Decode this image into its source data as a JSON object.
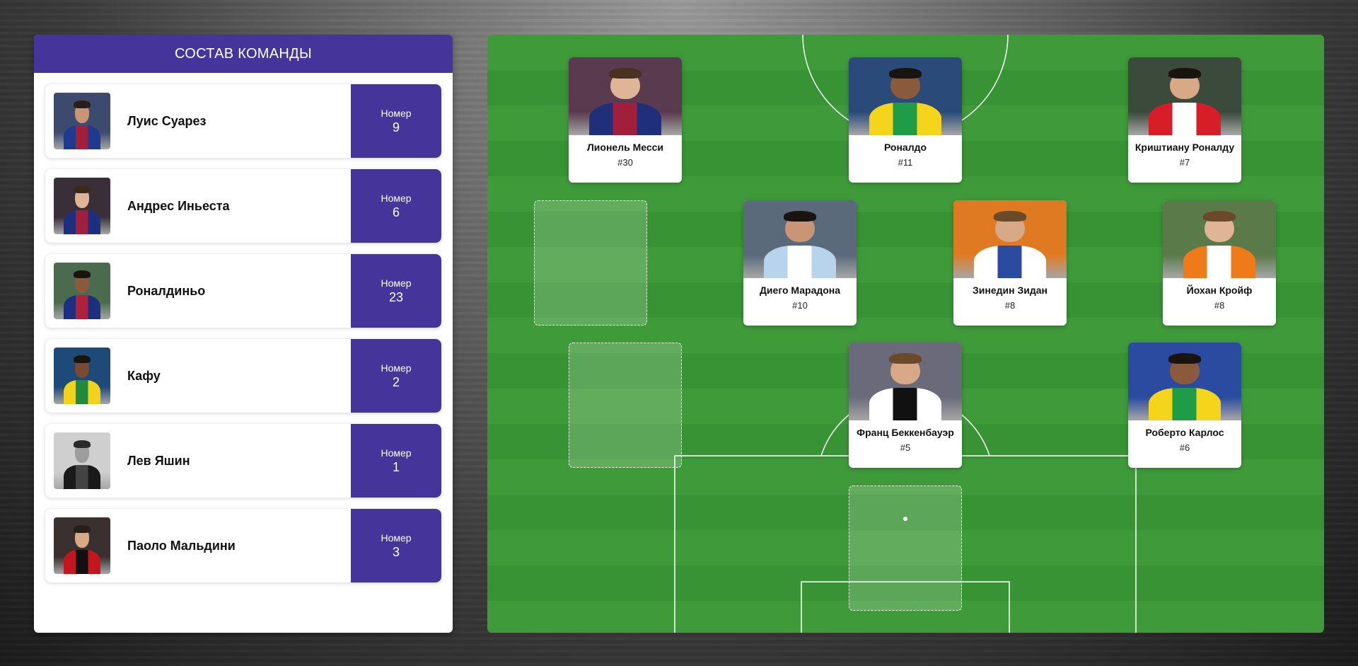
{
  "team": {
    "title": "СОСТАВ КОМАНДЫ",
    "number_label": "Номер",
    "players": [
      {
        "name": "Луис Суарез",
        "number": "9",
        "bg": "#3c4a6e",
        "shirt": "#1f3a8f",
        "shirt2": "#a11f3a",
        "skin": "#c99577",
        "hair": "#2a1f18"
      },
      {
        "name": "Андрес Иньеста",
        "number": "6",
        "bg": "#3a2f38",
        "shirt": "#1c2f80",
        "shirt2": "#a0203c",
        "skin": "#e0b597",
        "hair": "#3b2a1c"
      },
      {
        "name": "Роналдиньо",
        "number": "23",
        "bg": "#4b6b4e",
        "shirt": "#1c2f80",
        "shirt2": "#b0203c",
        "skin": "#8a5a3c",
        "hair": "#1a1410"
      },
      {
        "name": "Кафу",
        "number": "2",
        "bg": "#1e4a7a",
        "shirt": "#f2d21b",
        "shirt2": "#1f8b3e",
        "skin": "#7a4a30",
        "hair": "#1a1410"
      },
      {
        "name": "Лев Яшин",
        "number": "1",
        "bg": "#cfcfcf",
        "shirt": "#1a1a1a",
        "shirt2": "#444444",
        "skin": "#9d9d9d",
        "hair": "#2b2b2b"
      },
      {
        "name": "Паоло Мальдини",
        "number": "3",
        "bg": "#3a3030",
        "shirt": "#c4161c",
        "shirt2": "#111111",
        "skin": "#d8a987",
        "hair": "#2a1f18"
      }
    ]
  },
  "field": {
    "players": [
      {
        "name": "Лионель Месси",
        "number": "#30",
        "bg": "#5a3a4e",
        "shirt": "#1f2f7a",
        "shirt2": "#a11f3a",
        "skin": "#e0b597",
        "hair": "#4a3020"
      },
      {
        "name": "Роналдо",
        "number": "#11",
        "bg": "#2a4a7a",
        "shirt": "#f5d51c",
        "shirt2": "#1e9c48",
        "skin": "#8a5a3c",
        "hair": "#1a1410"
      },
      {
        "name": "Криштиану Роналду",
        "number": "#7",
        "bg": "#3c4a3c",
        "shirt": "#d71e28",
        "shirt2": "#ffffff",
        "skin": "#d8a987",
        "hair": "#1a1410"
      },
      {
        "name": "Диего Марадона",
        "number": "#10",
        "bg": "#5a6a7a",
        "shirt": "#b7d4ec",
        "shirt2": "#ffffff",
        "skin": "#c99577",
        "hair": "#1a1410"
      },
      {
        "name": "Зинедин Зидан",
        "number": "#8",
        "bg": "#e07a22",
        "shirt": "#ffffff",
        "shirt2": "#2a4ba0",
        "skin": "#d8a987",
        "hair": "#6a4a2a"
      },
      {
        "name": "Йохан Кройф",
        "number": "#8",
        "bg": "#5a7a4a",
        "shirt": "#ef7a1a",
        "shirt2": "#ffffff",
        "skin": "#e0b597",
        "hair": "#6a4a2a"
      },
      {
        "name": "Франц Беккенбауэр",
        "number": "#5",
        "bg": "#6a6a7a",
        "shirt": "#ffffff",
        "shirt2": "#111111",
        "skin": "#d8a987",
        "hair": "#6a4a2a"
      },
      {
        "name": "Роберто Карлос",
        "number": "#6",
        "bg": "#2a4ba0",
        "shirt": "#f5d51c",
        "shirt2": "#1e9c48",
        "skin": "#8a5a3c",
        "hair": "#1a1410"
      }
    ]
  },
  "colors": {
    "accent": "#45349a",
    "pitch": "#3f9a3a"
  }
}
